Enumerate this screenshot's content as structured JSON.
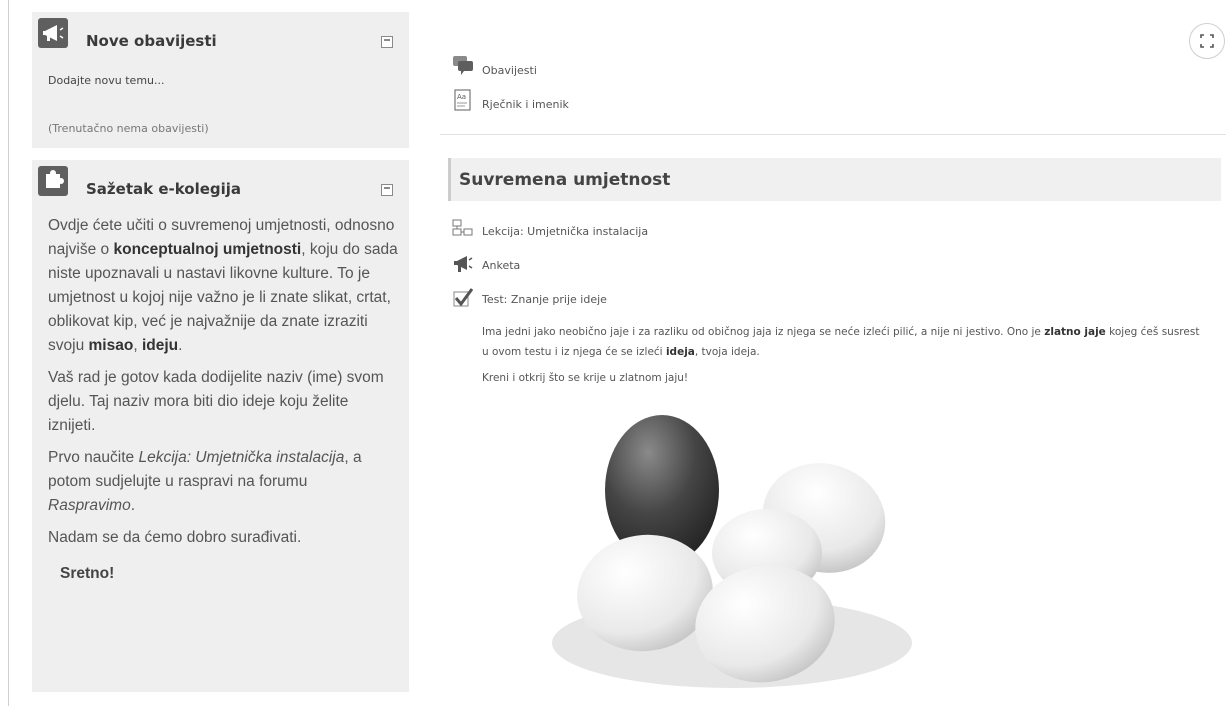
{
  "news_block": {
    "title": "Nove obavijesti",
    "add_topic": "Dodajte novu temu...",
    "empty": "(Trenutačno nema obavijesti)"
  },
  "summary_block": {
    "title": "Sažetak e-kolegija",
    "p1_a": "Ovdje ćete učiti o suvremenoj umjetnosti, odnosno najviše o ",
    "p1_b": "konceptualnoj umjetnosti",
    "p1_c": ", koju do sada niste upoznavali u nastavi likovne kulture. To je umjetnost u kojoj nije važno je li znate slikat, crtat, oblikovat kip, već je najvažnije da znate izraziti svoju ",
    "p1_d": "misao",
    "p1_e": ", ",
    "p1_f": "ideju",
    "p1_g": ".",
    "p2": "Vaš rad je gotov kada dodijelite naziv (ime) svom djelu. Taj naziv mora biti dio ideje koju želite iznijeti.",
    "p3_a": "Prvo naučite ",
    "p3_b": "Lekcija: Umjetnička instalacija",
    "p3_c": ", a potom sudjelujte u raspravi na forumu ",
    "p3_d": "Raspravimo",
    "p3_e": ".",
    "p4": "Nadam se da ćemo dobro surađivati.",
    "sign": "Sretno!"
  },
  "top_activities": {
    "forum": "Obavijesti",
    "glossary": "Rječnik i imenik"
  },
  "section": {
    "title": "Suvremena umjetnost",
    "lesson": "Lekcija: Umjetnička instalacija",
    "survey": "Anketa",
    "quiz": "Test: Znanje prije ideje",
    "desc_a": "Ima jedni jako neobično jaje i za razliku od običnog jaja iz njega se neće izleći pilić, a nije ni jestivo. Ono je ",
    "desc_b": "zlatno jaje",
    "desc_c": " kojeg ćeš susrest u ovom testu i iz njega će se izleći ",
    "desc_d": "ideja",
    "desc_e": ", tvoja ideja.",
    "cta": "Kreni i otkrij što se krije u zlatnom jaju!"
  },
  "icons": {
    "news": "megaphone-icon",
    "summary": "puzzle-icon",
    "forum": "forum-icon",
    "glossary": "glossary-icon",
    "lesson": "lesson-icon",
    "survey": "survey-icon",
    "quiz": "quiz-icon",
    "expand": "expand-icon"
  }
}
